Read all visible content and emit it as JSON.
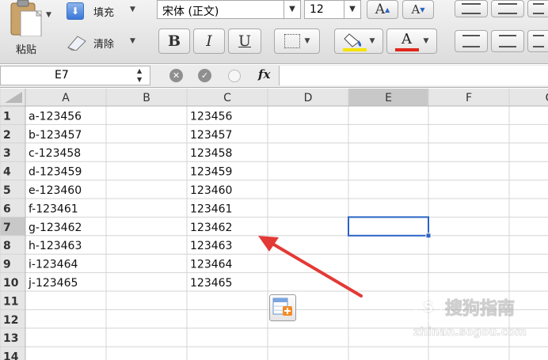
{
  "ribbon": {
    "paste_label": "粘贴",
    "fill_label": "填充",
    "clear_label": "清除",
    "font_name": "宋体 (正文)",
    "font_size": "12",
    "bold": "B",
    "italic": "I",
    "underline": "U",
    "font_grow": "A",
    "font_shrink": "A",
    "font_color_glyph": "A",
    "colors": {
      "highlight": "#f5e400",
      "font_color": "#e0261c",
      "accent": "#2a64c5"
    }
  },
  "formula_bar": {
    "name_box": "E7",
    "fx_label": "fx",
    "content": ""
  },
  "sheet": {
    "columns": [
      "A",
      "B",
      "C",
      "D",
      "E",
      "F",
      "G"
    ],
    "row_numbers": [
      "1",
      "2",
      "3",
      "4",
      "5",
      "6",
      "7",
      "8",
      "9",
      "10",
      "11",
      "12",
      "13",
      "14"
    ],
    "col_a": [
      "a-123456",
      "b-123457",
      "c-123458",
      "d-123459",
      "e-123460",
      "f-123461",
      "g-123462",
      "h-123463",
      "i-123464",
      "j-123465"
    ],
    "col_c": [
      "123456",
      "123457",
      "123458",
      "123459",
      "123460",
      "123461",
      "123462",
      "123463",
      "123464",
      "123465"
    ],
    "selected_cell": "E7"
  },
  "watermark": {
    "text": "搜狗指南",
    "subtext": "zhinan.sogou.com"
  }
}
